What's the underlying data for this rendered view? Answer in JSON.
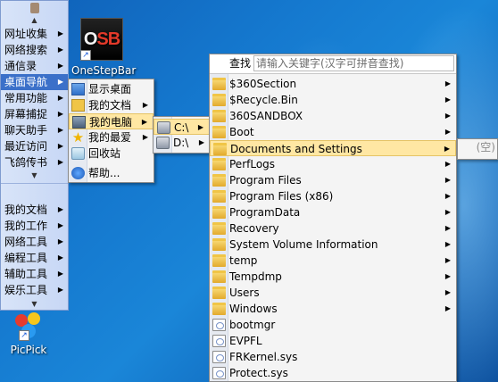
{
  "desktop": {
    "onestepbar": {
      "label": "OneStepBar",
      "logo_text_1": "O",
      "logo_text_2": "SB"
    },
    "picpick": {
      "label": "PicPick"
    }
  },
  "launcher": {
    "top_items": [
      {
        "label": "网址收集"
      },
      {
        "label": "网络搜索"
      },
      {
        "label": "通信录"
      },
      {
        "label": "桌面导航"
      },
      {
        "label": "常用功能"
      },
      {
        "label": "屏幕捕捉"
      },
      {
        "label": "聊天助手"
      },
      {
        "label": "最近访问"
      },
      {
        "label": "飞鸽传书"
      }
    ],
    "bottom_items": [
      {
        "label": "我的文档"
      },
      {
        "label": "我的工作"
      },
      {
        "label": "网络工具"
      },
      {
        "label": "编程工具"
      },
      {
        "label": "辅助工具"
      },
      {
        "label": "娱乐工具"
      }
    ]
  },
  "desktop_nav_menu": {
    "items": [
      {
        "label": "显示桌面",
        "icon": "desktop-icon"
      },
      {
        "label": "我的文档",
        "icon": "documents-icon"
      },
      {
        "label": "我的电脑",
        "icon": "computer-icon"
      },
      {
        "label": "我的最爱",
        "icon": "favorites-star-icon"
      },
      {
        "label": "回收站",
        "icon": "recycle-bin-icon"
      },
      {
        "label": "帮助...",
        "icon": "help-icon"
      }
    ]
  },
  "drives_menu": {
    "items": [
      {
        "label": "C:\\"
      },
      {
        "label": "D:\\"
      }
    ]
  },
  "c_drive_menu": {
    "search_label": "查找",
    "search_placeholder": "请输入关键字(汉字可拼音查找)",
    "items": [
      {
        "label": "$360Section",
        "type": "folder"
      },
      {
        "label": "$Recycle.Bin",
        "type": "folder"
      },
      {
        "label": "360SANDBOX",
        "type": "folder"
      },
      {
        "label": "Boot",
        "type": "folder"
      },
      {
        "label": "Documents and Settings",
        "type": "folder-shortcut"
      },
      {
        "label": "PerfLogs",
        "type": "folder"
      },
      {
        "label": "Program Files",
        "type": "folder"
      },
      {
        "label": "Program Files (x86)",
        "type": "folder"
      },
      {
        "label": "ProgramData",
        "type": "folder"
      },
      {
        "label": "Recovery",
        "type": "folder"
      },
      {
        "label": "System Volume Information",
        "type": "folder"
      },
      {
        "label": "temp",
        "type": "folder"
      },
      {
        "label": "Tempdmp",
        "type": "folder"
      },
      {
        "label": "Users",
        "type": "folder"
      },
      {
        "label": "Windows",
        "type": "folder"
      },
      {
        "label": "bootmgr",
        "type": "file"
      },
      {
        "label": "EVPFL",
        "type": "file"
      },
      {
        "label": "FRKernel.sys",
        "type": "file"
      },
      {
        "label": "Protect.sys",
        "type": "file"
      }
    ]
  },
  "docs_settings_submenu": {
    "empty_label": "(空)"
  }
}
